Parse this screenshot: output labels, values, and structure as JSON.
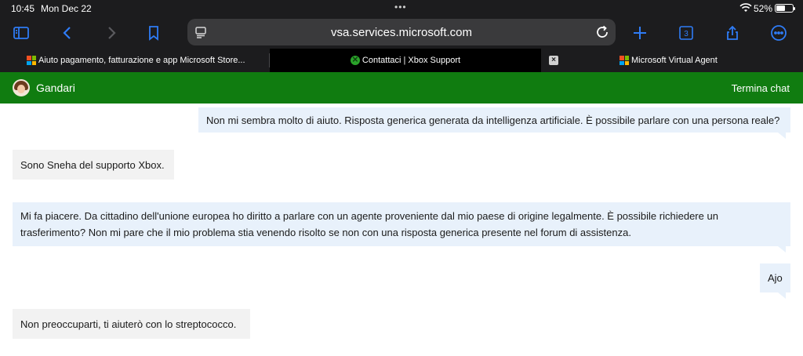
{
  "status": {
    "time": "10:45",
    "date": "Mon Dec 22",
    "battery_percent": "52%"
  },
  "browser": {
    "url": "vsa.services.microsoft.com",
    "tab_count": "3",
    "tabs": [
      {
        "title": "Aiuto pagamento, fatturazione e app Microsoft Store...",
        "icon": "microsoft-logo"
      },
      {
        "title": "Contattaci | Xbox Support",
        "icon": "xbox-logo"
      },
      {
        "title": "Microsoft Virtual Agent",
        "icon": "microsoft-logo"
      }
    ]
  },
  "chat": {
    "agent_name": "Gandari",
    "end_chat_label": "Termina chat",
    "messages": [
      {
        "from": "user",
        "text": "Non mi sembra molto di aiuto. Risposta generica generata da intelligenza artificiale. È possibile parlare con una persona reale?"
      },
      {
        "from": "agent",
        "text": "Sono Sneha del supporto Xbox."
      },
      {
        "from": "user",
        "text": "Mi fa piacere. Da cittadino dell'unione europea ho diritto a parlare con un agente proveniente dal mio paese di origine legalmente. È possibile richiedere un trasferimento? Non mi pare che il mio problema stia venendo risolto se non con una risposta generica presente nel forum di assistenza."
      },
      {
        "from": "user",
        "text": "Ajo"
      },
      {
        "from": "agent",
        "text": "Non preoccuparti, ti aiuterò con lo streptococco."
      }
    ]
  },
  "colors": {
    "header_green": "#107c10",
    "user_bubble": "#e8f1fb",
    "agent_bubble": "#f2f2f2",
    "toolbar_accent": "#2f7cf6"
  }
}
